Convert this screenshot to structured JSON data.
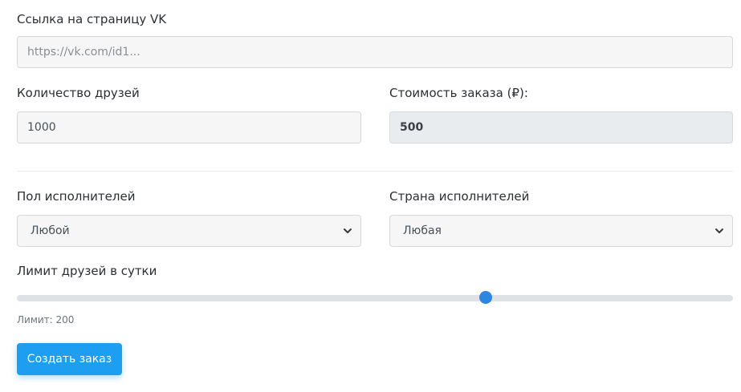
{
  "form": {
    "vk_link": {
      "label": "Ссылка на страницу VK",
      "placeholder": "https://vk.com/id1..."
    },
    "friends_count": {
      "label": "Количество друзей",
      "value": "1000"
    },
    "order_cost": {
      "label": "Стоимость заказа (₽):",
      "value": "500"
    },
    "gender": {
      "label": "Пол исполнителей",
      "selected": "Любой"
    },
    "country": {
      "label": "Страна исполнителей",
      "selected": "Любая"
    },
    "daily_limit": {
      "label": "Лимит друзей в сутки",
      "slider_fraction": 0.655,
      "readout": "Лимит: 200"
    },
    "submit_label": "Создать заказ"
  },
  "colors": {
    "accent": "#1e9ef0",
    "slider_thumb": "#2f86e0"
  },
  "icons": {
    "select_chevron": "chevron-down-icon"
  }
}
